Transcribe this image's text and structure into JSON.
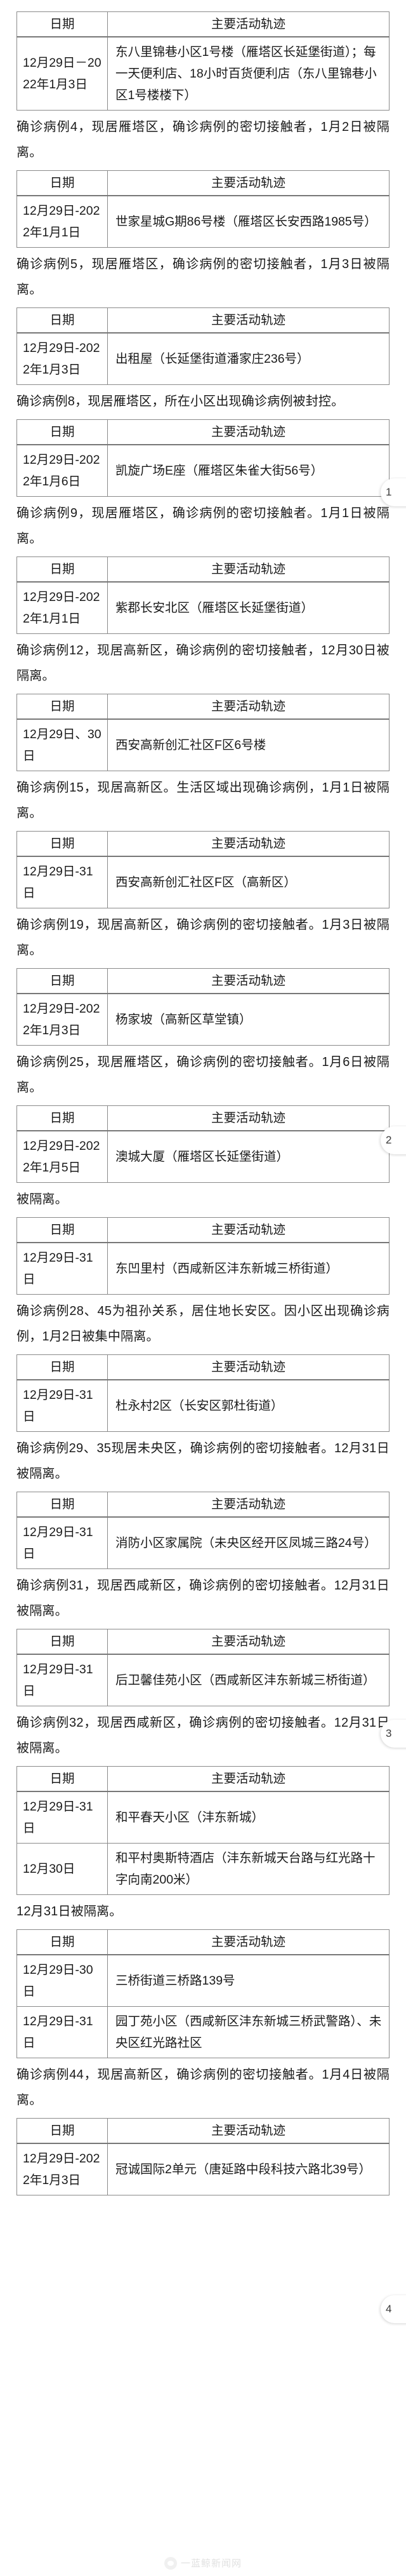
{
  "document": {
    "table_headers": {
      "date": "日期",
      "trace": "主要活动轨迹"
    },
    "watermark": "一蓝鲸新闻网",
    "page_pills": [
      {
        "label": "1"
      },
      {
        "label": "2"
      },
      {
        "label": "3"
      },
      {
        "label": "4"
      }
    ]
  },
  "blocks": [
    {
      "type": "table",
      "rows": [
        {
          "date": "12月29日－2022年1月3日",
          "trace": "东八里锦巷小区1号楼（雁塔区长延堡街道）；每一天便利店、18小时百货便利店（东八里锦巷小区1号楼楼下）"
        }
      ]
    },
    {
      "type": "note",
      "text": "确诊病例4，现居雁塔区，确诊病例的密切接触者，1月2日被隔离。"
    },
    {
      "type": "table",
      "rows": [
        {
          "date": "12月29日-2022年1月1日",
          "trace": "世家星城G期86号楼（雁塔区长安西路1985号）"
        }
      ]
    },
    {
      "type": "note",
      "text": "确诊病例5，现居雁塔区，确诊病例的密切接触者，1月3日被隔离。"
    },
    {
      "type": "table",
      "rows": [
        {
          "date": "12月29日-2022年1月3日",
          "trace": "出租屋（长延堡街道潘家庄236号）"
        }
      ]
    },
    {
      "type": "note",
      "text": "确诊病例8，现居雁塔区，所在小区出现确诊病例被封控。"
    },
    {
      "type": "table",
      "rows": [
        {
          "date": "12月29日-2022年1月6日",
          "trace": "凯旋广场E座（雁塔区朱雀大街56号）"
        }
      ]
    },
    {
      "type": "note",
      "text": "确诊病例9，现居雁塔区，确诊病例的密切接触者。1月1日被隔离。"
    },
    {
      "type": "table",
      "rows": [
        {
          "date": "12月29日-2022年1月1日",
          "trace": "紫郡长安北区（雁塔区长延堡街道）"
        }
      ]
    },
    {
      "type": "note",
      "text": "确诊病例12，现居高新区，确诊病例的密切接触者，12月30日被隔离。"
    },
    {
      "type": "table",
      "rows": [
        {
          "date": "12月29日、30日",
          "trace": "西安高新创汇社区F区6号楼"
        }
      ]
    },
    {
      "type": "note",
      "text": "确诊病例15，现居高新区。生活区域出现确诊病例，1月1日被隔离。"
    },
    {
      "type": "table",
      "rows": [
        {
          "date": "12月29日-31日",
          "trace": "西安高新创汇社区F区（高新区）"
        }
      ]
    },
    {
      "type": "note",
      "text": "确诊病例19，现居高新区，确诊病例的密切接触者。1月3日被隔离。"
    },
    {
      "type": "table",
      "rows": [
        {
          "date": "12月29日-2022年1月3日",
          "trace": "杨家坡（高新区草堂镇）"
        }
      ]
    },
    {
      "type": "note",
      "text": "确诊病例25，现居雁塔区，确诊病例的密切接触者。1月6日被隔离。"
    },
    {
      "type": "table",
      "rows": [
        {
          "date": "12月29日-2022年1月5日",
          "trace": "澳城大厦（雁塔区长延堡街道）"
        }
      ]
    },
    {
      "type": "note",
      "text": "被隔离。"
    },
    {
      "type": "table",
      "rows": [
        {
          "date": "12月29日-31日",
          "trace": "东凹里村（西咸新区沣东新城三桥街道）"
        }
      ]
    },
    {
      "type": "note",
      "text": "确诊病例28、45为祖孙关系，居住地长安区。因小区出现确诊病例，1月2日被集中隔离。"
    },
    {
      "type": "table",
      "rows": [
        {
          "date": "12月29日-31日",
          "trace": "杜永村2区（长安区郭杜街道）"
        }
      ]
    },
    {
      "type": "note",
      "text": "确诊病例29、35现居未央区，确诊病例的密切接触者。12月31日被隔离。"
    },
    {
      "type": "table",
      "rows": [
        {
          "date": "12月29日-31日",
          "trace": "消防小区家属院（未央区经开区凤城三路24号）"
        }
      ]
    },
    {
      "type": "note",
      "text": "确诊病例31，现居西咸新区，确诊病例的密切接触者。12月31日被隔离。"
    },
    {
      "type": "table",
      "rows": [
        {
          "date": "12月29日-31日",
          "trace": "后卫馨佳苑小区（西咸新区沣东新城三桥街道）"
        }
      ]
    },
    {
      "type": "note",
      "text": "确诊病例32，现居西咸新区，确诊病例的密切接触者。12月31日被隔离。"
    },
    {
      "type": "table",
      "rows": [
        {
          "date": "12月29日-31日",
          "trace": "和平春天小区（沣东新城）"
        },
        {
          "date": "12月30日",
          "trace": "和平村奥斯特酒店（沣东新城天台路与红光路十字向南200米）"
        }
      ]
    },
    {
      "type": "note",
      "text": "12月31日被隔离。"
    },
    {
      "type": "table",
      "rows": [
        {
          "date": "12月29日-30日",
          "trace": "三桥街道三桥路139号"
        },
        {
          "date": "12月29日-31日",
          "trace": "园丁苑小区（西咸新区沣东新城三桥武警路）、未央区红光路社区"
        }
      ]
    },
    {
      "type": "note",
      "text": "确诊病例44，现居高新区，确诊病例的密切接触者。1月4日被隔离。"
    },
    {
      "type": "table",
      "rows": [
        {
          "date": "12月29日-2022年1月3日",
          "trace": "冠诚国际2单元（唐延路中段科技六路北39号）"
        }
      ]
    }
  ]
}
